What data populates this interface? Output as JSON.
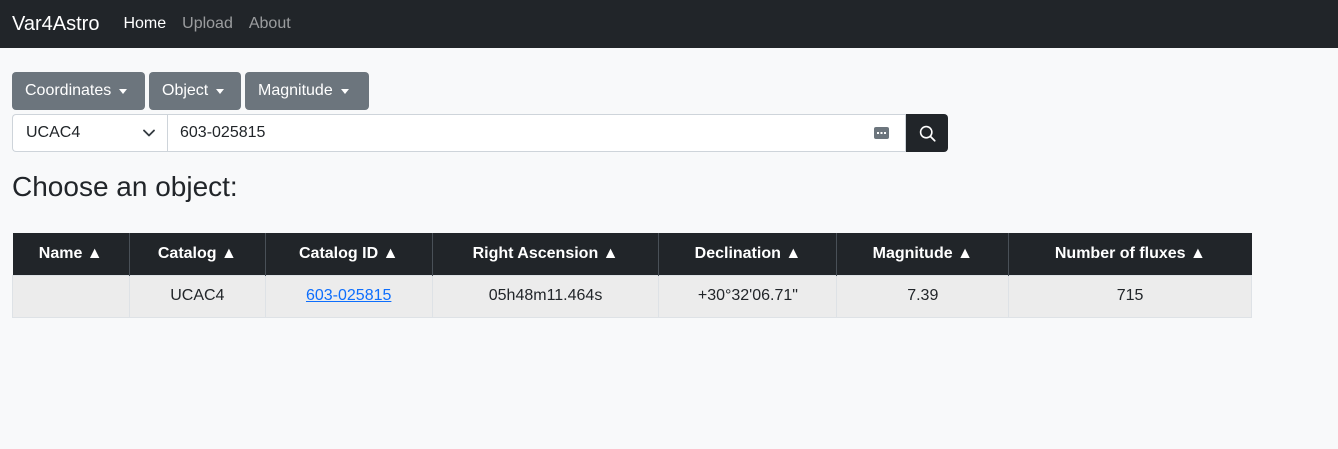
{
  "navbar": {
    "brand": "Var4Astro",
    "links": [
      {
        "label": "Home"
      },
      {
        "label": "Upload"
      },
      {
        "label": "About"
      }
    ]
  },
  "filters": {
    "coordinates": "Coordinates",
    "object": "Object",
    "magnitude": "Magnitude"
  },
  "search": {
    "catalog": "UCAC4",
    "query": "603-025815"
  },
  "page_title": "Choose an object:",
  "table": {
    "headers": [
      "Name ▲",
      "Catalog ▲",
      "Catalog ID ▲",
      "Right Ascension ▲",
      "Declination ▲",
      "Magnitude ▲",
      "Number of fluxes ▲"
    ],
    "rows": [
      {
        "name": "",
        "catalog": "UCAC4",
        "catalog_id": "603-025815",
        "ra": "05h48m11.464s",
        "dec": "+30°32'06.71\"",
        "magnitude": "7.39",
        "fluxes": "715"
      }
    ]
  },
  "colors": {
    "navbar_bg": "#212529",
    "secondary_btn": "#6c757d",
    "link": "#0d6efd"
  }
}
